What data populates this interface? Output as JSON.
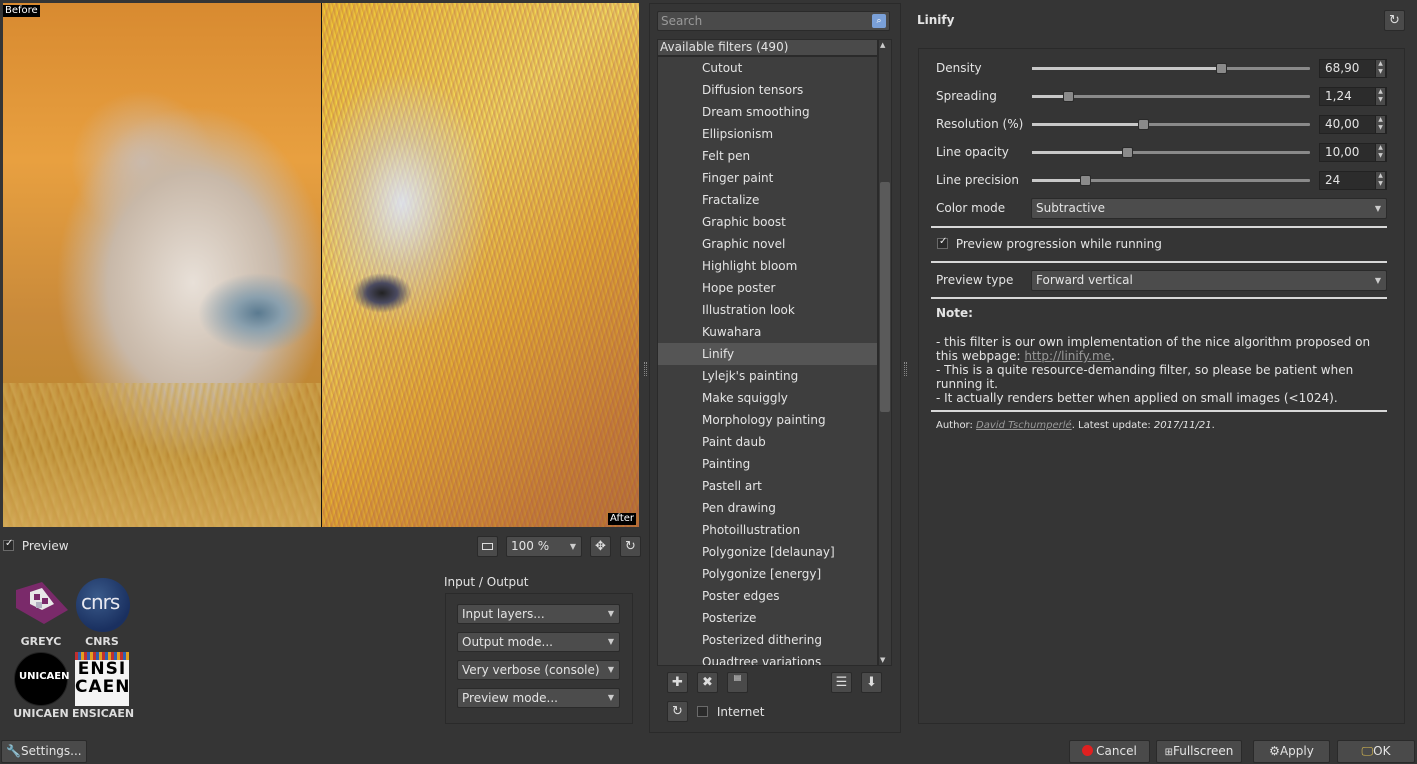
{
  "preview": {
    "before_label": "Before",
    "after_label": "After",
    "preview_checkbox_label": "Preview",
    "zoom_value": "100 %"
  },
  "logos": [
    {
      "name": "GREYC"
    },
    {
      "name": "CNRS"
    },
    {
      "name": "UNICAEN"
    },
    {
      "name": "ENSICAEN"
    }
  ],
  "logo_text": {
    "cnrs": "cnrs",
    "unicaen": "UNICAEN",
    "ensi": "ENSI",
    "caen": "CAEN"
  },
  "io": {
    "title": "Input / Output",
    "input_layers": "Input layers...",
    "output_mode": "Output mode...",
    "verbosity": "Very verbose (console)",
    "preview_mode": "Preview mode..."
  },
  "filters": {
    "search_placeholder": "Search",
    "header": "Available filters (490)",
    "selected": "Linify",
    "items": [
      "Cutout",
      "Diffusion tensors",
      "Dream smoothing",
      "Ellipsionism",
      "Felt pen",
      "Finger paint",
      "Fractalize",
      "Graphic boost",
      "Graphic novel",
      "Highlight bloom",
      "Hope poster",
      "Illustration look",
      "Kuwahara",
      "Linify",
      "Lylejk's painting",
      "Make squiggly",
      "Morphology painting",
      "Paint daub",
      "Painting",
      "Pastell art",
      "Pen drawing",
      "Photoillustration",
      "Polygonize [delaunay]",
      "Polygonize [energy]",
      "Poster edges",
      "Posterize",
      "Posterized dithering",
      "Quadtree variations"
    ],
    "internet_label": "Internet"
  },
  "filter_panel": {
    "title": "Linify",
    "params": [
      {
        "label": "Density",
        "value": "68,90",
        "fraction": 0.68
      },
      {
        "label": "Spreading",
        "value": "1,24",
        "fraction": 0.13
      },
      {
        "label": "Resolution (%)",
        "value": "40,00",
        "fraction": 0.4
      },
      {
        "label": "Line opacity",
        "value": "10,00",
        "fraction": 0.34
      },
      {
        "label": "Line precision",
        "value": "24",
        "fraction": 0.19
      }
    ],
    "color_mode_label": "Color mode",
    "color_mode_value": "Subtractive",
    "preview_progression_label": "Preview progression while running",
    "preview_type_label": "Preview type",
    "preview_type_value": "Forward vertical",
    "note_title": "Note:",
    "note_line1_prefix": "- this filter is our own implementation of the nice algorithm proposed on this webpage: ",
    "note_link": "http://linify.me",
    "note_line1_suffix": ".",
    "note_line2": "- This is a quite resource-demanding filter, so please be patient when running it.",
    "note_line3": "- It actually renders better when applied on small images (<1024).",
    "author_prefix": "Author: ",
    "author_name": "David Tschumperlé",
    "update_prefix": ". Latest update: ",
    "update_date": "2017/11/21",
    "update_suffix": "."
  },
  "bottom": {
    "settings": "Settings...",
    "cancel": "Cancel",
    "fullscreen": "Fullscreen",
    "apply": "Apply",
    "ok": "OK"
  }
}
